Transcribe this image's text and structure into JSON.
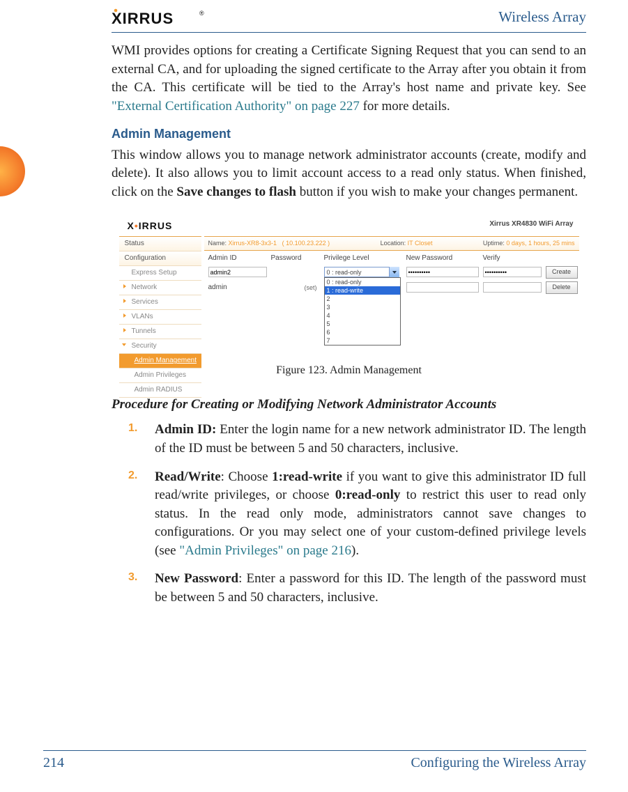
{
  "header": {
    "product": "Wireless Array"
  },
  "intro": {
    "text_before_link": "WMI provides options for creating a Certificate Signing Request that you can send to an external CA, and for uploading the signed certificate to the Array after you obtain it from the CA. This certificate will be tied to the Array's host name and private key. See ",
    "link_text": "\"External Certification Authority\" on page 227",
    "text_after_link": " for more details."
  },
  "section": {
    "heading": "Admin Management",
    "text_before_bold": "This window allows you to manage network administrator accounts (create, modify and delete). It also allows you to limit account access to a read only status. When finished, click on the ",
    "bold": "Save changes to flash",
    "text_after_bold": " button if you wish to make your changes permanent."
  },
  "ui": {
    "device_label": "Xirrus XR4830 WiFi Array",
    "statusbar": {
      "name_k": "Name:",
      "name_v": "Xirrus-XR8-3x3-1",
      "ip": "( 10.100.23.222 )",
      "loc_k": "Location:",
      "loc_v": "IT Closet",
      "up_k": "Uptime:",
      "up_v": "0 days, 1 hours, 25 mins"
    },
    "sidebar": {
      "status": "Status",
      "configuration": "Configuration",
      "express": "Express Setup",
      "network": "Network",
      "services": "Services",
      "vlans": "VLANs",
      "tunnels": "Tunnels",
      "security": "Security",
      "admin_mgmt": "Admin Management",
      "admin_priv": "Admin Privileges",
      "admin_radius": "Admin RADIUS"
    },
    "headers": {
      "c1": "Admin ID",
      "c2": "Password",
      "c3": "Privilege Level",
      "c4": "New Password",
      "c5": "Verify",
      "c6": ""
    },
    "row1": {
      "admin_id": "admin2",
      "priv_selected": "0 : read-only",
      "new_pw": "••••••••••",
      "verify": "••••••••••",
      "button": "Create"
    },
    "row2": {
      "admin_id": "admin",
      "pw_state": "(set)",
      "button": "Delete"
    },
    "dropdown": {
      "opt0": "0 : read-only",
      "opt1": "1 : read-write",
      "opt2": "2",
      "opt3": "3",
      "opt4": "4",
      "opt5": "5",
      "opt6": "6",
      "opt7": "7"
    }
  },
  "figure_caption": "Figure 123. Admin Management",
  "procedure": {
    "heading": "Procedure for Creating or Modifying Network Administrator Accounts",
    "step1": {
      "num": "1.",
      "lead": "Admin ID:",
      "text": " Enter the login name for a new network administrator ID. The length of the ID must be between 5 and 50 characters, inclusive."
    },
    "step2": {
      "num": "2.",
      "lead": "Read/Write",
      "t1": ": Choose ",
      "b1": "1:read-write",
      "t2": " if you want to give this administrator ID full read/write privileges, or choose ",
      "b2": "0:read-only",
      "t3": " to restrict this user to read only status. In the read only mode, administrators cannot save changes to configurations. Or you may select one of your custom-defined privilege levels (see ",
      "link": "\"Admin Privileges\" on page 216",
      "t4": ")."
    },
    "step3": {
      "num": "3.",
      "lead": "New Password",
      "text": ": Enter a password for this ID. The length of the password must be between 5 and 50 characters, inclusive."
    }
  },
  "footer": {
    "page": "214",
    "chapter": "Configuring the Wireless Array"
  }
}
